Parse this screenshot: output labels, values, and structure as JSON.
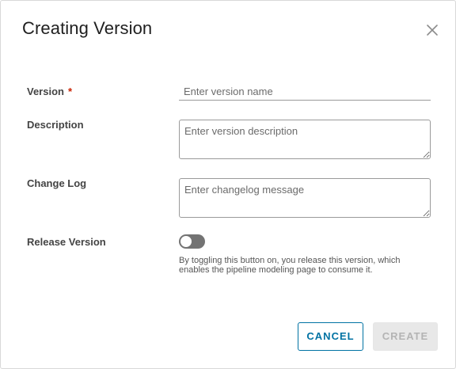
{
  "dialog": {
    "title": "Creating Version",
    "close_icon": "close-icon"
  },
  "form": {
    "version": {
      "label": "Version",
      "required_mark": "*",
      "placeholder": "Enter version name",
      "value": ""
    },
    "description": {
      "label": "Description",
      "placeholder": "Enter version description",
      "value": ""
    },
    "change_log": {
      "label": "Change Log",
      "placeholder": "Enter changelog message",
      "value": ""
    },
    "release_version": {
      "label": "Release Version",
      "enabled": false,
      "helper": "By toggling this button on, you release this version, which enables the pipeline modeling page to consume it."
    }
  },
  "actions": {
    "cancel_label": "CANCEL",
    "create_label": "CREATE",
    "create_disabled": true
  },
  "colors": {
    "accent": "#0072a3",
    "required": "#c92100",
    "toggle_off": "#737373"
  }
}
